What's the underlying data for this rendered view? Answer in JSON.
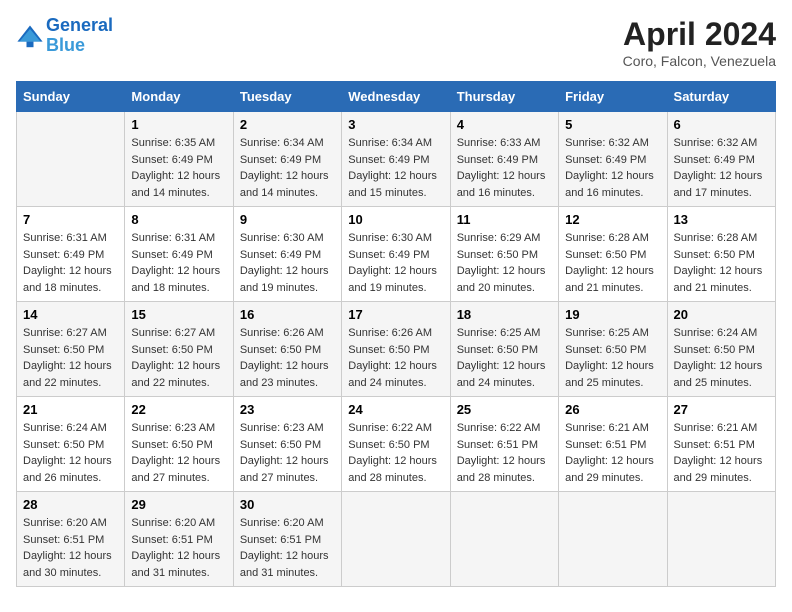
{
  "logo": {
    "line1": "General",
    "line2": "Blue"
  },
  "title": "April 2024",
  "subtitle": "Coro, Falcon, Venezuela",
  "days_of_week": [
    "Sunday",
    "Monday",
    "Tuesday",
    "Wednesday",
    "Thursday",
    "Friday",
    "Saturday"
  ],
  "weeks": [
    [
      {
        "num": "",
        "sunrise": "",
        "sunset": "",
        "daylight": ""
      },
      {
        "num": "1",
        "sunrise": "Sunrise: 6:35 AM",
        "sunset": "Sunset: 6:49 PM",
        "daylight": "Daylight: 12 hours and 14 minutes."
      },
      {
        "num": "2",
        "sunrise": "Sunrise: 6:34 AM",
        "sunset": "Sunset: 6:49 PM",
        "daylight": "Daylight: 12 hours and 14 minutes."
      },
      {
        "num": "3",
        "sunrise": "Sunrise: 6:34 AM",
        "sunset": "Sunset: 6:49 PM",
        "daylight": "Daylight: 12 hours and 15 minutes."
      },
      {
        "num": "4",
        "sunrise": "Sunrise: 6:33 AM",
        "sunset": "Sunset: 6:49 PM",
        "daylight": "Daylight: 12 hours and 16 minutes."
      },
      {
        "num": "5",
        "sunrise": "Sunrise: 6:32 AM",
        "sunset": "Sunset: 6:49 PM",
        "daylight": "Daylight: 12 hours and 16 minutes."
      },
      {
        "num": "6",
        "sunrise": "Sunrise: 6:32 AM",
        "sunset": "Sunset: 6:49 PM",
        "daylight": "Daylight: 12 hours and 17 minutes."
      }
    ],
    [
      {
        "num": "7",
        "sunrise": "Sunrise: 6:31 AM",
        "sunset": "Sunset: 6:49 PM",
        "daylight": "Daylight: 12 hours and 18 minutes."
      },
      {
        "num": "8",
        "sunrise": "Sunrise: 6:31 AM",
        "sunset": "Sunset: 6:49 PM",
        "daylight": "Daylight: 12 hours and 18 minutes."
      },
      {
        "num": "9",
        "sunrise": "Sunrise: 6:30 AM",
        "sunset": "Sunset: 6:49 PM",
        "daylight": "Daylight: 12 hours and 19 minutes."
      },
      {
        "num": "10",
        "sunrise": "Sunrise: 6:30 AM",
        "sunset": "Sunset: 6:49 PM",
        "daylight": "Daylight: 12 hours and 19 minutes."
      },
      {
        "num": "11",
        "sunrise": "Sunrise: 6:29 AM",
        "sunset": "Sunset: 6:50 PM",
        "daylight": "Daylight: 12 hours and 20 minutes."
      },
      {
        "num": "12",
        "sunrise": "Sunrise: 6:28 AM",
        "sunset": "Sunset: 6:50 PM",
        "daylight": "Daylight: 12 hours and 21 minutes."
      },
      {
        "num": "13",
        "sunrise": "Sunrise: 6:28 AM",
        "sunset": "Sunset: 6:50 PM",
        "daylight": "Daylight: 12 hours and 21 minutes."
      }
    ],
    [
      {
        "num": "14",
        "sunrise": "Sunrise: 6:27 AM",
        "sunset": "Sunset: 6:50 PM",
        "daylight": "Daylight: 12 hours and 22 minutes."
      },
      {
        "num": "15",
        "sunrise": "Sunrise: 6:27 AM",
        "sunset": "Sunset: 6:50 PM",
        "daylight": "Daylight: 12 hours and 22 minutes."
      },
      {
        "num": "16",
        "sunrise": "Sunrise: 6:26 AM",
        "sunset": "Sunset: 6:50 PM",
        "daylight": "Daylight: 12 hours and 23 minutes."
      },
      {
        "num": "17",
        "sunrise": "Sunrise: 6:26 AM",
        "sunset": "Sunset: 6:50 PM",
        "daylight": "Daylight: 12 hours and 24 minutes."
      },
      {
        "num": "18",
        "sunrise": "Sunrise: 6:25 AM",
        "sunset": "Sunset: 6:50 PM",
        "daylight": "Daylight: 12 hours and 24 minutes."
      },
      {
        "num": "19",
        "sunrise": "Sunrise: 6:25 AM",
        "sunset": "Sunset: 6:50 PM",
        "daylight": "Daylight: 12 hours and 25 minutes."
      },
      {
        "num": "20",
        "sunrise": "Sunrise: 6:24 AM",
        "sunset": "Sunset: 6:50 PM",
        "daylight": "Daylight: 12 hours and 25 minutes."
      }
    ],
    [
      {
        "num": "21",
        "sunrise": "Sunrise: 6:24 AM",
        "sunset": "Sunset: 6:50 PM",
        "daylight": "Daylight: 12 hours and 26 minutes."
      },
      {
        "num": "22",
        "sunrise": "Sunrise: 6:23 AM",
        "sunset": "Sunset: 6:50 PM",
        "daylight": "Daylight: 12 hours and 27 minutes."
      },
      {
        "num": "23",
        "sunrise": "Sunrise: 6:23 AM",
        "sunset": "Sunset: 6:50 PM",
        "daylight": "Daylight: 12 hours and 27 minutes."
      },
      {
        "num": "24",
        "sunrise": "Sunrise: 6:22 AM",
        "sunset": "Sunset: 6:50 PM",
        "daylight": "Daylight: 12 hours and 28 minutes."
      },
      {
        "num": "25",
        "sunrise": "Sunrise: 6:22 AM",
        "sunset": "Sunset: 6:51 PM",
        "daylight": "Daylight: 12 hours and 28 minutes."
      },
      {
        "num": "26",
        "sunrise": "Sunrise: 6:21 AM",
        "sunset": "Sunset: 6:51 PM",
        "daylight": "Daylight: 12 hours and 29 minutes."
      },
      {
        "num": "27",
        "sunrise": "Sunrise: 6:21 AM",
        "sunset": "Sunset: 6:51 PM",
        "daylight": "Daylight: 12 hours and 29 minutes."
      }
    ],
    [
      {
        "num": "28",
        "sunrise": "Sunrise: 6:20 AM",
        "sunset": "Sunset: 6:51 PM",
        "daylight": "Daylight: 12 hours and 30 minutes."
      },
      {
        "num": "29",
        "sunrise": "Sunrise: 6:20 AM",
        "sunset": "Sunset: 6:51 PM",
        "daylight": "Daylight: 12 hours and 31 minutes."
      },
      {
        "num": "30",
        "sunrise": "Sunrise: 6:20 AM",
        "sunset": "Sunset: 6:51 PM",
        "daylight": "Daylight: 12 hours and 31 minutes."
      },
      {
        "num": "",
        "sunrise": "",
        "sunset": "",
        "daylight": ""
      },
      {
        "num": "",
        "sunrise": "",
        "sunset": "",
        "daylight": ""
      },
      {
        "num": "",
        "sunrise": "",
        "sunset": "",
        "daylight": ""
      },
      {
        "num": "",
        "sunrise": "",
        "sunset": "",
        "daylight": ""
      }
    ]
  ]
}
